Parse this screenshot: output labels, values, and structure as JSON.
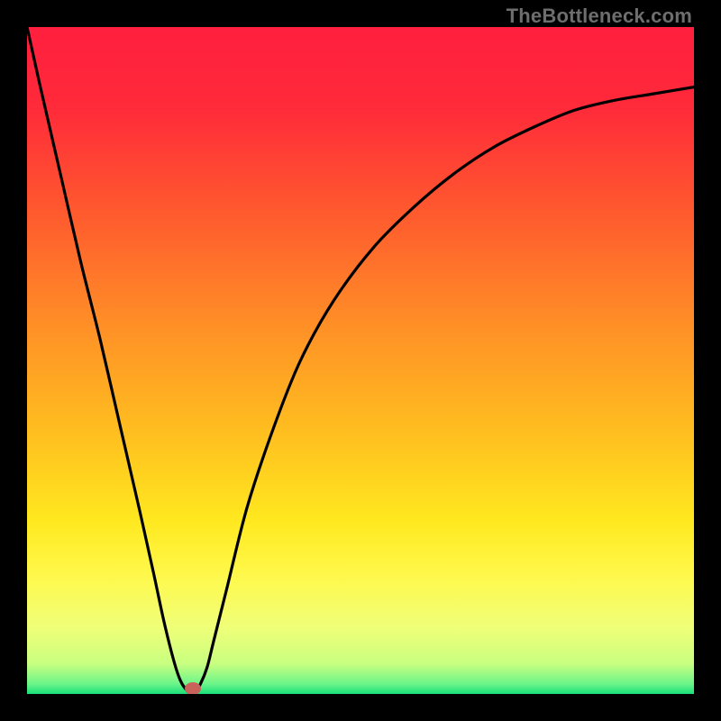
{
  "watermark": "TheBottleneck.com",
  "colors": {
    "frame": "#000000",
    "gradient_stops": [
      {
        "offset": 0.0,
        "color": "#ff1f3f"
      },
      {
        "offset": 0.12,
        "color": "#ff2a3a"
      },
      {
        "offset": 0.28,
        "color": "#ff5a2e"
      },
      {
        "offset": 0.46,
        "color": "#ff9326"
      },
      {
        "offset": 0.62,
        "color": "#ffc21f"
      },
      {
        "offset": 0.74,
        "color": "#ffe81f"
      },
      {
        "offset": 0.82,
        "color": "#fff84a"
      },
      {
        "offset": 0.9,
        "color": "#f0ff78"
      },
      {
        "offset": 0.955,
        "color": "#c8ff80"
      },
      {
        "offset": 0.985,
        "color": "#6cf58a"
      },
      {
        "offset": 1.0,
        "color": "#18e07a"
      }
    ],
    "curve": "#000000",
    "marker_fill": "#c9625b",
    "marker_stroke": "#c9625b"
  },
  "chart_data": {
    "type": "line",
    "title": "",
    "xlabel": "",
    "ylabel": "",
    "xlim": [
      0,
      100
    ],
    "ylim": [
      0,
      100
    ],
    "grid": false,
    "series": [
      {
        "name": "bottleneck-curve",
        "x": [
          0,
          2,
          5,
          8,
          11,
          14,
          17,
          19,
          20.5,
          22,
          23,
          24,
          25,
          26,
          27,
          28,
          30,
          33,
          37,
          41,
          46,
          52,
          58,
          64,
          70,
          76,
          82,
          88,
          94,
          100
        ],
        "y": [
          100,
          91,
          78,
          65,
          53,
          40,
          27,
          18,
          11,
          5,
          2,
          0.5,
          0,
          1.5,
          4,
          8,
          16,
          28,
          40,
          50,
          59,
          67,
          73,
          78,
          82,
          85,
          87.5,
          89,
          90,
          91
        ]
      }
    ],
    "annotations": [
      {
        "name": "optimal-marker",
        "x": 24.8,
        "y": 0.8,
        "shape": "ellipse"
      }
    ]
  }
}
